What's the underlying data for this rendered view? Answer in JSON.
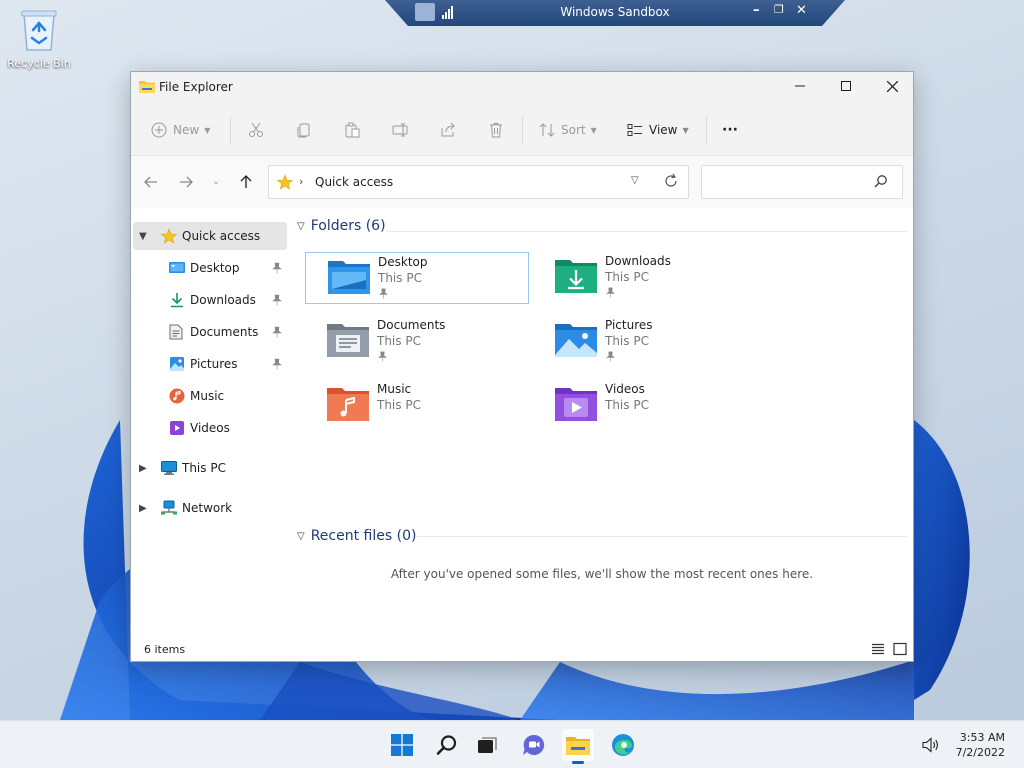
{
  "desktop": {
    "recycle_bin_label": "Recycle Bin"
  },
  "sandbox_bar": {
    "title": "Windows Sandbox",
    "minimize_glyph": "–",
    "restore_glyph": "❐",
    "close_glyph": "✕"
  },
  "window": {
    "title": "File Explorer",
    "accent_color": "#0067c0"
  },
  "commandbar": {
    "new_label": "New",
    "sort_label": "Sort",
    "view_label": "View",
    "more_label": "···"
  },
  "address": {
    "separator": "›",
    "path": "Quick access",
    "search_placeholder": ""
  },
  "nav": {
    "quick_access": "Quick access",
    "items": [
      {
        "label": "Desktop"
      },
      {
        "label": "Downloads"
      },
      {
        "label": "Documents"
      },
      {
        "label": "Pictures"
      },
      {
        "label": "Music"
      },
      {
        "label": "Videos"
      }
    ],
    "this_pc": "This PC",
    "network": "Network"
  },
  "content": {
    "folders_header": "Folders (6)",
    "recent_header": "Recent files (0)",
    "recent_empty": "After you've opened some files, we'll show the most recent ones here.",
    "folders": [
      {
        "name": "Desktop",
        "location": "This PC"
      },
      {
        "name": "Downloads",
        "location": "This PC"
      },
      {
        "name": "Documents",
        "location": "This PC"
      },
      {
        "name": "Pictures",
        "location": "This PC"
      },
      {
        "name": "Music",
        "location": "This PC"
      },
      {
        "name": "Videos",
        "location": "This PC"
      }
    ]
  },
  "status": {
    "item_count": "6 items"
  },
  "taskbar": {
    "time": "3:53 AM",
    "date": "7/2/2022"
  }
}
